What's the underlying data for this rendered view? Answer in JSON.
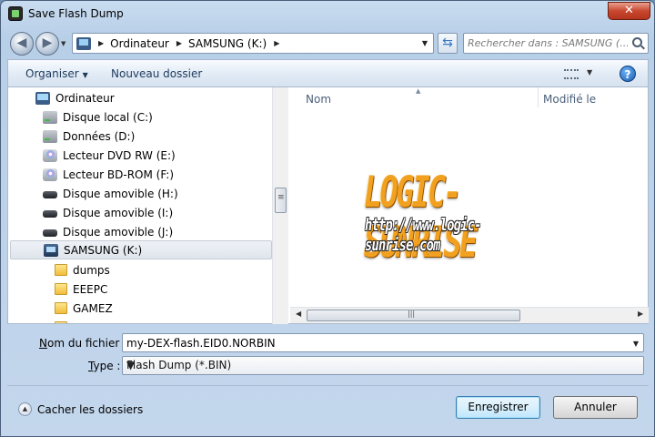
{
  "window": {
    "title": "Save Flash Dump",
    "close_label": "✕"
  },
  "nav": {
    "breadcrumb": [
      "Ordinateur",
      "SAMSUNG (K:)"
    ],
    "search_placeholder": "Rechercher dans : SAMSUNG (..."
  },
  "toolbar": {
    "organise_label": "Organiser",
    "new_folder_label": "Nouveau dossier"
  },
  "tree": {
    "root": "Ordinateur",
    "items": [
      {
        "label": "Disque local (C:)",
        "icon": "hdd-icon"
      },
      {
        "label": "Données (D:)",
        "icon": "hdd-icon"
      },
      {
        "label": "Lecteur DVD RW (E:)",
        "icon": "dvd-drive-icon"
      },
      {
        "label": "Lecteur BD-ROM (F:)",
        "icon": "dvd-drive-icon"
      },
      {
        "label": "Disque amovible (H:)",
        "icon": "removable-drive-icon"
      },
      {
        "label": "Disque amovible (I:)",
        "icon": "removable-drive-icon"
      },
      {
        "label": "Disque amovible (J:)",
        "icon": "removable-drive-icon"
      },
      {
        "label": "SAMSUNG (K:)",
        "icon": "usb-drive-icon",
        "selected": true
      }
    ],
    "folders": [
      "dumps",
      "EEEPC",
      "GAMEZ"
    ]
  },
  "filelist": {
    "columns": [
      "Nom",
      "Modifié le"
    ],
    "watermark_title": "LOGIC-SUNRISE",
    "watermark_url": "http://www.logic-sunrise.com"
  },
  "form": {
    "filename_label_accesskey": "N",
    "filename_label_rest": "om du fichier :",
    "filename_value": "my-DEX-flash.EID0.NORBIN",
    "type_label_accesskey": "T",
    "type_label_rest": "ype :",
    "type_value": "Flash Dump (*.BIN)"
  },
  "footer": {
    "hide_folders_label": "Cacher les dossiers",
    "save_label": "Enregistrer",
    "cancel_label": "Annuler"
  }
}
